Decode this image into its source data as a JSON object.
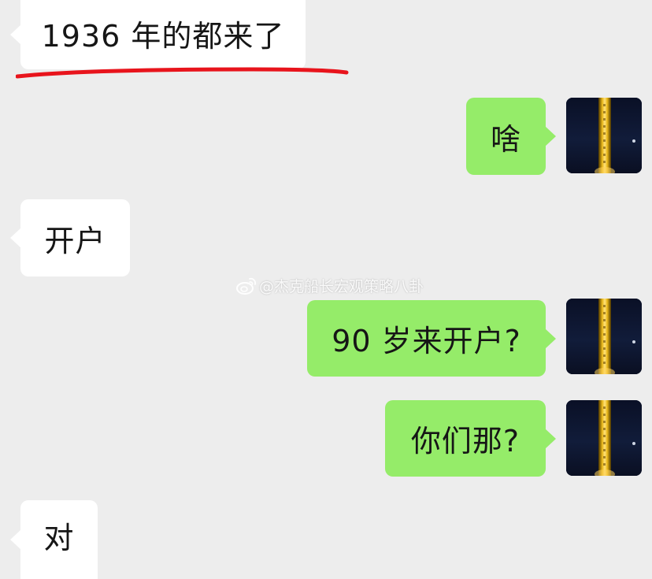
{
  "messages": [
    {
      "id": "m1",
      "side": "in",
      "text": "1936 年的都来了"
    },
    {
      "id": "m2",
      "side": "out",
      "text": "啥"
    },
    {
      "id": "m3",
      "side": "in",
      "text": "开户"
    },
    {
      "id": "m4",
      "side": "out",
      "text": "90 岁来开户?"
    },
    {
      "id": "m5",
      "side": "out",
      "text": "你们那?"
    },
    {
      "id": "m6",
      "side": "in",
      "text": "对"
    }
  ],
  "watermark": {
    "text": "@杰克船长宏观策略八卦",
    "icon": "weibo-logo-icon"
  },
  "annotation": {
    "type": "red-underline",
    "color": "#e8141c"
  },
  "avatar": {
    "icon": "self-avatar-image"
  },
  "colors": {
    "background": "#ededed",
    "incoming_bubble": "#ffffff",
    "outgoing_bubble": "#95ec69",
    "text": "#161616"
  }
}
